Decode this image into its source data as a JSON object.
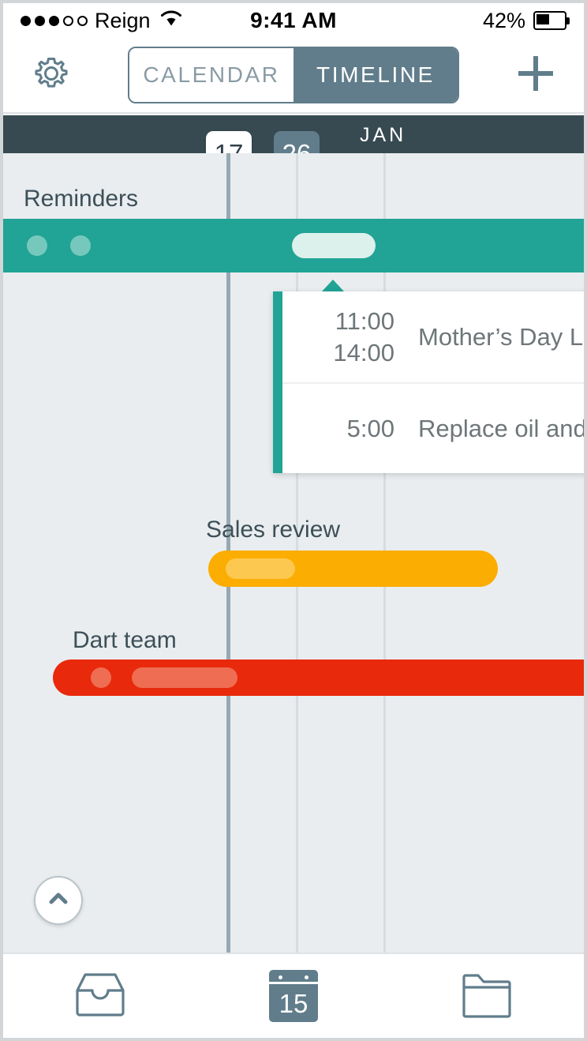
{
  "status_bar": {
    "carrier": "Reign",
    "signal_dots_filled": 3,
    "signal_dots_total": 5,
    "wifi_icon": "wifi-icon",
    "time": "9:41 AM",
    "battery_percent": "42%",
    "battery_level": 42
  },
  "nav_bar": {
    "settings_icon": "gear-icon",
    "add_icon": "plus-icon",
    "toggle": {
      "calendar_label": "CALENDAR",
      "timeline_label": "TIMELINE",
      "selected": "TIMELINE"
    }
  },
  "timeline": {
    "month_label": "JAN",
    "today_badge": "17",
    "marker_badge": "26",
    "tracks": [
      {
        "label": "Reminders",
        "color": "#21a395"
      },
      {
        "label": "Sales review",
        "color": "#fcad01"
      },
      {
        "label": "Dart team",
        "color": "#e8290b"
      }
    ],
    "collapse_icon": "chevron-up-icon"
  },
  "event_popup": {
    "accent_color": "#21a395",
    "rows": [
      {
        "time": "11:00\n14:00",
        "time_start": "11:00",
        "time_end": "14:00",
        "title": "Mother’s Day Lunc"
      },
      {
        "time": "5:00",
        "time_start": "5:00",
        "time_end": "",
        "title": "Replace oil and f..."
      }
    ]
  },
  "tab_bar": {
    "items": [
      {
        "name": "inbox",
        "icon": "inbox-icon",
        "active": false
      },
      {
        "name": "calendar",
        "icon": "calendar-icon",
        "day": "15",
        "active": true
      },
      {
        "name": "folder",
        "icon": "folder-icon",
        "active": false
      }
    ]
  },
  "colors": {
    "accent_slate": "#617d8b",
    "header_dark": "#374a52",
    "background": "#e9edef",
    "teal": "#21a395",
    "orange": "#fcad01",
    "red": "#e8290b"
  }
}
